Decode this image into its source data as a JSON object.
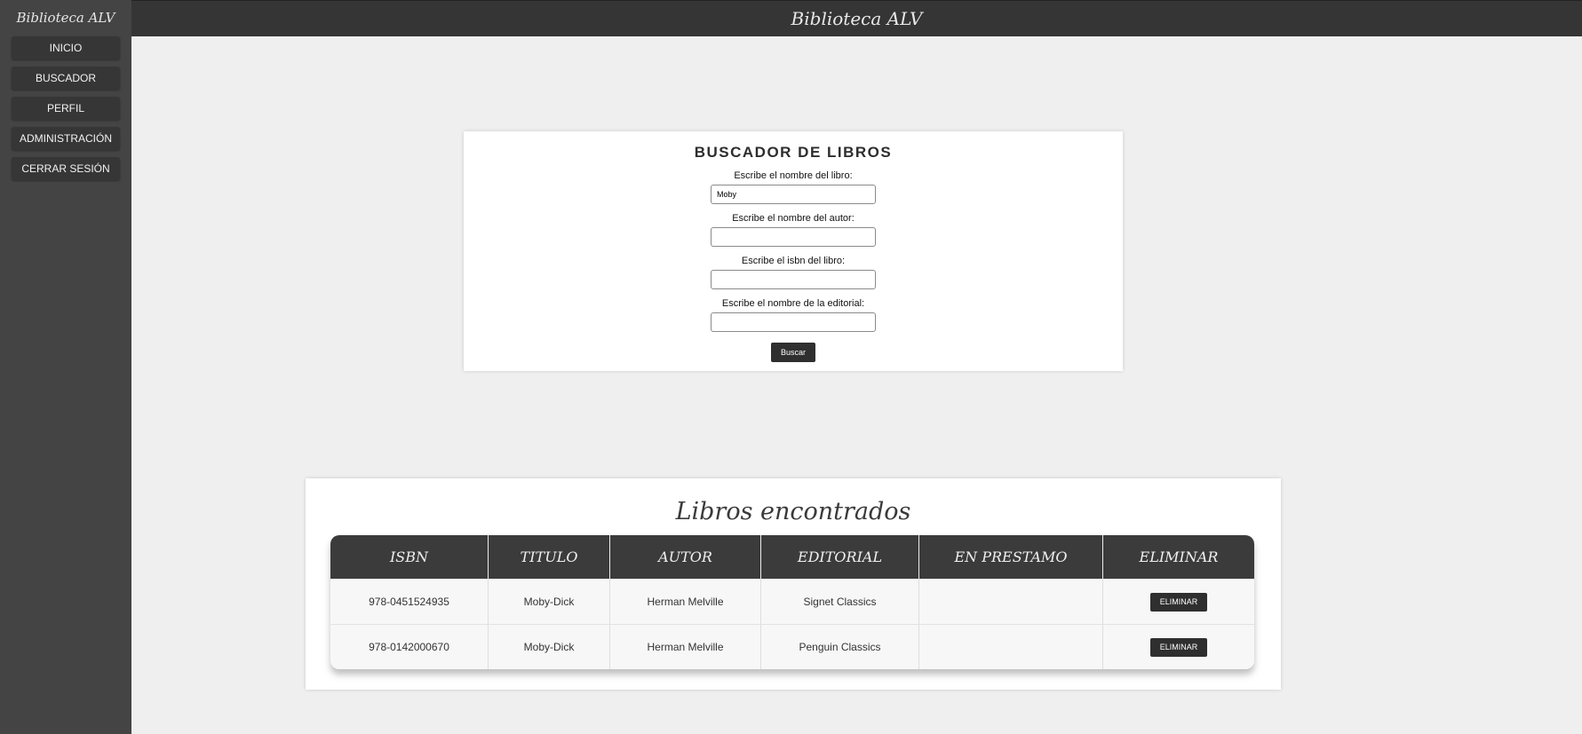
{
  "sidebar": {
    "brand": "Biblioteca ALV",
    "items": [
      {
        "label": "INICIO"
      },
      {
        "label": "BUSCADOR"
      },
      {
        "label": "PERFIL"
      },
      {
        "label": "ADMINISTRACIÓN"
      },
      {
        "label": "CERRAR SESIÓN"
      }
    ]
  },
  "header": {
    "title": "Biblioteca ALV"
  },
  "search": {
    "title": "BUSCADOR DE LIBROS",
    "fields": [
      {
        "label": "Escribe el nombre del libro:",
        "value": "Moby"
      },
      {
        "label": "Escribe el nombre del autor:",
        "value": ""
      },
      {
        "label": "Escribe el isbn del libro:",
        "value": ""
      },
      {
        "label": "Escribe el nombre de la editorial:",
        "value": ""
      }
    ],
    "button_label": "Buscar"
  },
  "results": {
    "title": "Libros encontrados",
    "columns": [
      "ISBN",
      "TITULO",
      "AUTOR",
      "EDITORIAL",
      "EN PRESTAMO",
      "ELIMINAR"
    ],
    "rows": [
      {
        "isbn": "978-0451524935",
        "titulo": "Moby-Dick",
        "autor": "Herman Melville",
        "editorial": "Signet Classics",
        "en_prestamo": "",
        "action": "ELIMINAR"
      },
      {
        "isbn": "978-0142000670",
        "titulo": "Moby-Dick",
        "autor": "Herman Melville",
        "editorial": "Penguin Classics",
        "en_prestamo": "",
        "action": "ELIMINAR"
      }
    ]
  },
  "colors": {
    "sidebar_bg": "#444444",
    "topbar_bg": "#353535",
    "page_bg": "#efefef",
    "button_bg": "#2f2f2f"
  }
}
